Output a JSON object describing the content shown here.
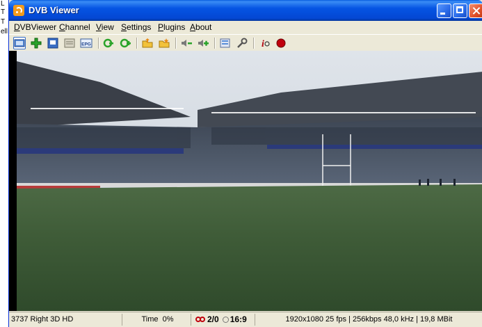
{
  "background_window": {
    "fragments": [
      "L",
      "T",
      "T",
      "ell"
    ]
  },
  "window": {
    "title": "DVB Viewer"
  },
  "menu": [
    {
      "first": "D",
      "rest": "VBViewer"
    },
    {
      "first": "C",
      "rest": "hannel"
    },
    {
      "first": "V",
      "rest": "iew"
    },
    {
      "first": "S",
      "rest": "ettings"
    },
    {
      "first": "P",
      "rest": "lugins"
    },
    {
      "first": "A",
      "rest": "bout"
    }
  ],
  "toolbar": {
    "icons": [
      "display-icon",
      "zoom-in-icon",
      "teletext-icon",
      "osd-icon",
      "epg-icon",
      "channel-down-icon",
      "channel-up-icon",
      "folder-open-icon",
      "favorites-icon",
      "volume-down-icon",
      "volume-up-icon",
      "recorder-icon",
      "settings-wrench-icon",
      "info-icon",
      "record-icon"
    ],
    "epg_label": "EPG",
    "info_label": "i"
  },
  "video": {
    "description_colors": {
      "sky": "#cfd6de",
      "grass": "#3e5a35",
      "stand": "#4a5566"
    }
  },
  "status": {
    "channel": "3737 Right 3D HD",
    "time_label": "Time",
    "time_value": "0%",
    "audio_tracks": "2/0",
    "aspect": "16:9",
    "stream_info": "1920x1080 25 fps | 256kbps 48,0 kHz | 19,8 MBit"
  }
}
